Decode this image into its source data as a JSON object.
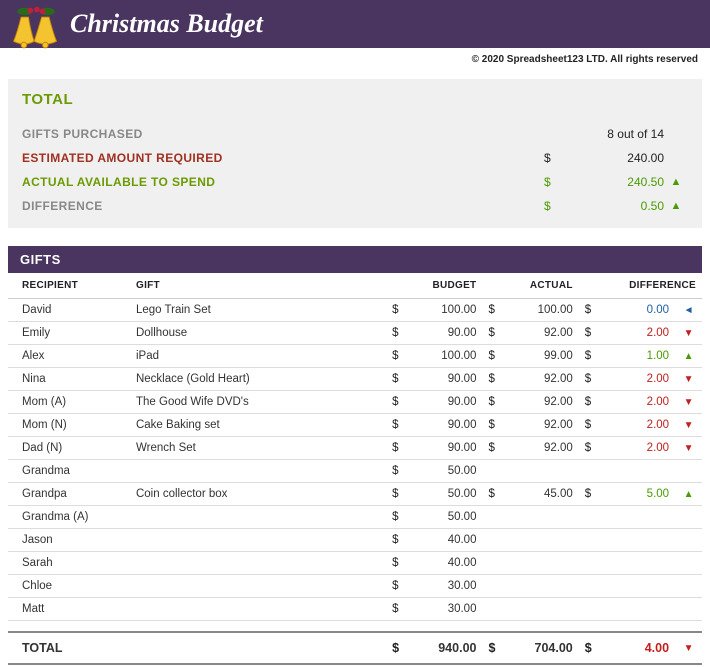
{
  "header": {
    "title": "Christmas Budget"
  },
  "copyright": "© 2020 Spreadsheet123 LTD. All rights reserved",
  "summary": {
    "title": "TOTAL",
    "gifts_purchased_label": "GIFTS PURCHASED",
    "gifts_purchased_value": "8 out of 14",
    "estimated_label": "ESTIMATED AMOUNT REQUIRED",
    "estimated_currency": "$",
    "estimated_value": "240.00",
    "actual_label": "ACTUAL AVAILABLE TO SPEND",
    "actual_currency": "$",
    "actual_value": "240.50",
    "actual_arrow": "▲",
    "difference_label": "DIFFERENCE",
    "difference_currency": "$",
    "difference_value": "0.50",
    "difference_arrow": "▲"
  },
  "gifts_section": {
    "title": "GIFTS",
    "headers": {
      "recipient": "RECIPIENT",
      "gift": "GIFT",
      "budget": "BUDGET",
      "actual": "ACTUAL",
      "difference": "DIFFERENCE"
    },
    "rows": [
      {
        "recipient": "David",
        "gift": "Lego Train Set",
        "bcur": "$",
        "budget": "100.00",
        "acur": "$",
        "actual": "100.00",
        "dcur": "$",
        "diff": "0.00",
        "arrow": "◄",
        "color": "blue"
      },
      {
        "recipient": "Emily",
        "gift": "Dollhouse",
        "bcur": "$",
        "budget": "90.00",
        "acur": "$",
        "actual": "92.00",
        "dcur": "$",
        "diff": "2.00",
        "arrow": "▼",
        "color": "red"
      },
      {
        "recipient": "Alex",
        "gift": "iPad",
        "bcur": "$",
        "budget": "100.00",
        "acur": "$",
        "actual": "99.00",
        "dcur": "$",
        "diff": "1.00",
        "arrow": "▲",
        "color": "green"
      },
      {
        "recipient": "Nina",
        "gift": "Necklace (Gold Heart)",
        "bcur": "$",
        "budget": "90.00",
        "acur": "$",
        "actual": "92.00",
        "dcur": "$",
        "diff": "2.00",
        "arrow": "▼",
        "color": "red"
      },
      {
        "recipient": "Mom (A)",
        "gift": "The Good Wife DVD's",
        "bcur": "$",
        "budget": "90.00",
        "acur": "$",
        "actual": "92.00",
        "dcur": "$",
        "diff": "2.00",
        "arrow": "▼",
        "color": "red"
      },
      {
        "recipient": "Mom (N)",
        "gift": "Cake Baking set",
        "bcur": "$",
        "budget": "90.00",
        "acur": "$",
        "actual": "92.00",
        "dcur": "$",
        "diff": "2.00",
        "arrow": "▼",
        "color": "red"
      },
      {
        "recipient": "Dad (N)",
        "gift": "Wrench Set",
        "bcur": "$",
        "budget": "90.00",
        "acur": "$",
        "actual": "92.00",
        "dcur": "$",
        "diff": "2.00",
        "arrow": "▼",
        "color": "red"
      },
      {
        "recipient": "Grandma",
        "gift": "",
        "bcur": "$",
        "budget": "50.00",
        "acur": "",
        "actual": "",
        "dcur": "",
        "diff": "",
        "arrow": "",
        "color": ""
      },
      {
        "recipient": "Grandpa",
        "gift": "Coin collector box",
        "bcur": "$",
        "budget": "50.00",
        "acur": "$",
        "actual": "45.00",
        "dcur": "$",
        "diff": "5.00",
        "arrow": "▲",
        "color": "green"
      },
      {
        "recipient": "Grandma (A)",
        "gift": "",
        "bcur": "$",
        "budget": "50.00",
        "acur": "",
        "actual": "",
        "dcur": "",
        "diff": "",
        "arrow": "",
        "color": ""
      },
      {
        "recipient": "Jason",
        "gift": "",
        "bcur": "$",
        "budget": "40.00",
        "acur": "",
        "actual": "",
        "dcur": "",
        "diff": "",
        "arrow": "",
        "color": ""
      },
      {
        "recipient": "Sarah",
        "gift": "",
        "bcur": "$",
        "budget": "40.00",
        "acur": "",
        "actual": "",
        "dcur": "",
        "diff": "",
        "arrow": "",
        "color": ""
      },
      {
        "recipient": "Chloe",
        "gift": "",
        "bcur": "$",
        "budget": "30.00",
        "acur": "",
        "actual": "",
        "dcur": "",
        "diff": "",
        "arrow": "",
        "color": ""
      },
      {
        "recipient": "Matt",
        "gift": "",
        "bcur": "$",
        "budget": "30.00",
        "acur": "",
        "actual": "",
        "dcur": "",
        "diff": "",
        "arrow": "",
        "color": ""
      }
    ],
    "totals": {
      "label": "TOTAL",
      "bcur": "$",
      "budget": "940.00",
      "acur": "$",
      "actual": "704.00",
      "dcur": "$",
      "diff": "4.00",
      "arrow": "▼",
      "color": "red"
    }
  }
}
